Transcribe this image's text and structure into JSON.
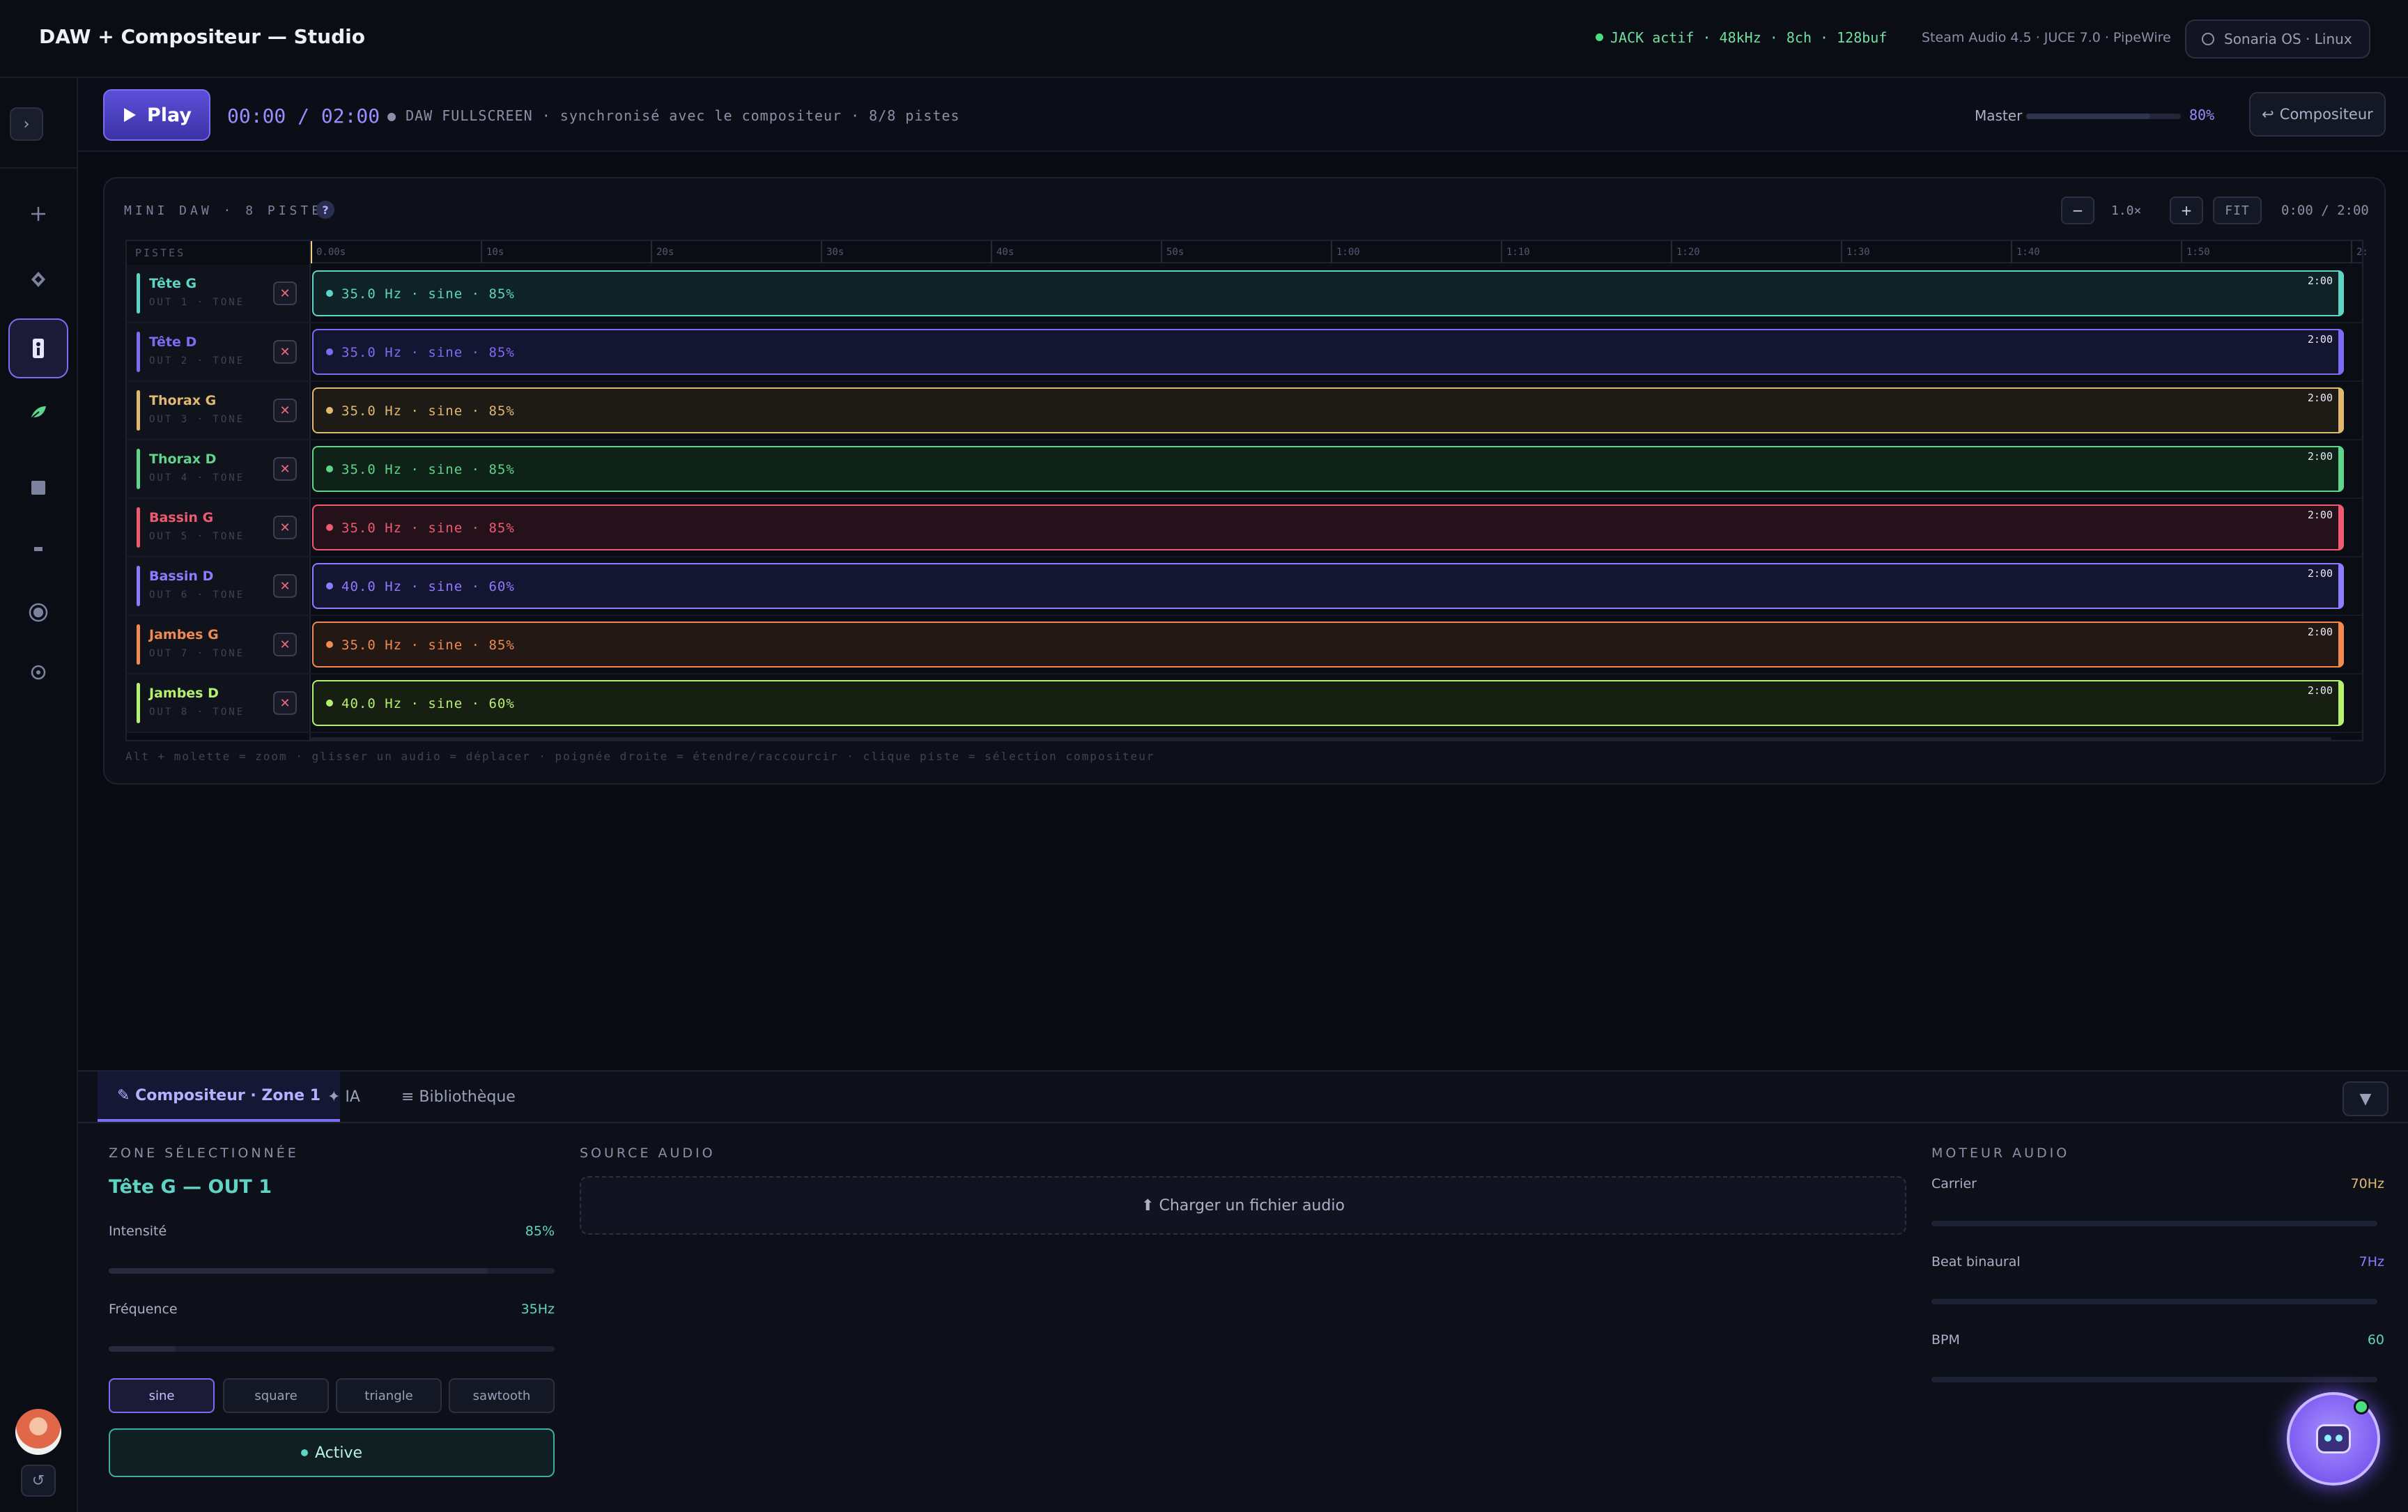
{
  "app": {
    "title": "DAW + Compositeur — Studio",
    "jack_status": "JACK actif · 48kHz · 8ch · 128buf",
    "engine_info": "Steam Audio 4.5 · JUCE 7.0 · PipeWire",
    "os_badge": "Sonaria OS · Linux"
  },
  "sidebar": {
    "toggle": "›",
    "icons": [
      "add-icon",
      "diamond-icon",
      "body-map-icon",
      "leaf-icon",
      "square-icon",
      "minus-icon",
      "disc-icon",
      "target-icon"
    ],
    "history": "↺"
  },
  "transport": {
    "play_label": "Play",
    "time": "00:00 / 02:00",
    "sync_text": "● DAW FULLSCREEN · synchronisé avec le compositeur · 8/8 pistes",
    "master_label": "Master",
    "master_value": "80%",
    "master_level": 0.8,
    "compositor_label": "Compositeur"
  },
  "mini_daw": {
    "label": "MINI DAW · 8 PISTES",
    "help": "?",
    "zoom_out": "−",
    "zoom_level": "1.0×",
    "zoom_in": "+",
    "fit": "FIT",
    "time": "0:00 / 2:00",
    "pistes_label": "PISTES",
    "ruler": [
      "0.00s",
      "10s",
      "20s",
      "30s",
      "40s",
      "50s",
      "1:00",
      "1:10",
      "1:20",
      "1:30",
      "1:40",
      "1:50",
      "2:"
    ],
    "hint": "Alt + molette = zoom · glisser un audio = déplacer · poignée droite = étendre/raccourcir · clique piste = sélection compositeur",
    "tracks": [
      {
        "name": "Tête G",
        "out": "OUT 1 · TONE",
        "clip": "35.0 Hz · sine · 85%",
        "end": "2:00",
        "color": "#5fd4c4",
        "bg": "#0f2226"
      },
      {
        "name": "Tête D",
        "out": "OUT 2 · TONE",
        "clip": "35.0 Hz · sine · 85%",
        "end": "2:00",
        "color": "#7c6cf2",
        "bg": "#141530"
      },
      {
        "name": "Thorax G",
        "out": "OUT 3 · TONE",
        "clip": "35.0 Hz · sine · 85%",
        "end": "2:00",
        "color": "#e0b870",
        "bg": "#1e1a16"
      },
      {
        "name": "Thorax D",
        "out": "OUT 4 · TONE",
        "clip": "35.0 Hz · sine · 85%",
        "end": "2:00",
        "color": "#5fd48a",
        "bg": "#0f2218"
      },
      {
        "name": "Bassin G",
        "out": "OUT 5 · TONE",
        "clip": "35.0 Hz · sine · 85%",
        "end": "2:00",
        "color": "#f05a70",
        "bg": "#24111a"
      },
      {
        "name": "Bassin D",
        "out": "OUT 6 · TONE",
        "clip": "40.0 Hz · sine · 60%",
        "end": "2:00",
        "color": "#8c7cff",
        "bg": "#141530"
      },
      {
        "name": "Jambes G",
        "out": "OUT 7 · TONE",
        "clip": "35.0 Hz · sine · 85%",
        "end": "2:00",
        "color": "#f08a50",
        "bg": "#231814"
      },
      {
        "name": "Jambes D",
        "out": "OUT 8 · TONE",
        "clip": "40.0 Hz · sine · 60%",
        "end": "2:00",
        "color": "#b6f070",
        "bg": "#171f12"
      }
    ]
  },
  "bottom": {
    "tabs": {
      "compositor": "✎ Compositeur · Zone 1",
      "ia": "✦ IA",
      "library": "≡ Bibliothèque"
    },
    "collapse": "▼",
    "zone": {
      "title": "ZONE SÉLECTIONNÉE",
      "name": "Tête G — OUT 1",
      "intensity_label": "Intensité",
      "intensity_value": "85%",
      "intensity_level": 0.85,
      "frequency_label": "Fréquence",
      "frequency_value": "35Hz",
      "frequency_level": 0.15,
      "waves": [
        "sine",
        "square",
        "triangle",
        "sawtooth"
      ],
      "selected_wave": "sine",
      "active_label": "Active"
    },
    "source": {
      "title": "SOURCE AUDIO",
      "upload_label": "⬆ Charger un fichier audio"
    },
    "engine": {
      "title": "MOTEUR AUDIO",
      "carrier_label": "Carrier",
      "carrier_value": "70Hz",
      "beat_label": "Beat binaural",
      "beat_value": "7Hz",
      "bpm_label": "BPM",
      "bpm_value": "60"
    }
  },
  "colors": {
    "accent": "#7c6cf2",
    "teal": "#5fd4c4",
    "background": "#090b12"
  }
}
